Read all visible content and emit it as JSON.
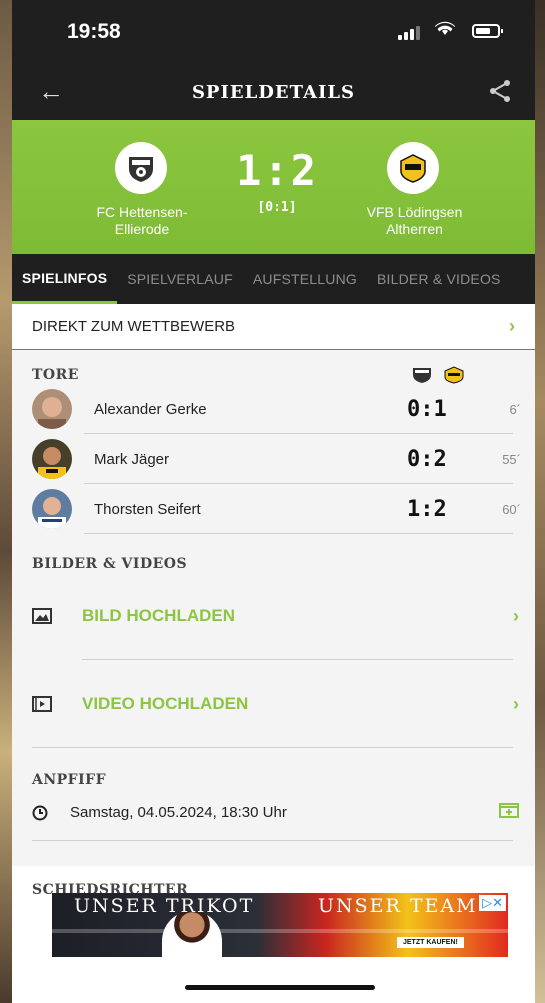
{
  "status_bar": {
    "time": "19:58"
  },
  "header": {
    "title": "SPIELDETAILS"
  },
  "match": {
    "home_team": "FC Hettensen-\nEllierode",
    "away_team": "VFB Lödingsen\nAltherren",
    "score": "1:2",
    "halftime": "[0:1]"
  },
  "tabs": [
    {
      "label": "SPIELINFOS",
      "active": true
    },
    {
      "label": "SPIELVERLAUF",
      "active": false
    },
    {
      "label": "AUFSTELLUNG",
      "active": false
    },
    {
      "label": "BILDER & VIDEOS",
      "active": false
    }
  ],
  "competition_link": "DIREKT ZUM WETTBEWERB",
  "goals": {
    "heading": "TORE",
    "items": [
      {
        "name": "Alexander Gerke",
        "score": "0:1",
        "minute": "6´"
      },
      {
        "name": "Mark Jäger",
        "score": "0:2",
        "minute": "55´"
      },
      {
        "name": "Thorsten Seifert",
        "score": "1:2",
        "minute": "60´"
      }
    ]
  },
  "media": {
    "heading": "BILDER & VIDEOS",
    "upload_image": "BILD HOCHLADEN",
    "upload_video": "VIDEO HOCHLADEN"
  },
  "kickoff": {
    "heading": "ANPFIFF",
    "datetime": "Samstag, 04.05.2024, 18:30 Uhr"
  },
  "partial_heading": "SCHIEDSRICHTER",
  "ad": {
    "text_left": "UNSER TRIKOT",
    "text_right": "UNSER TEAM",
    "cta": "JETZT KAUFEN!"
  },
  "colors": {
    "accent": "#8cc63f",
    "dark": "#1f1f1f"
  }
}
